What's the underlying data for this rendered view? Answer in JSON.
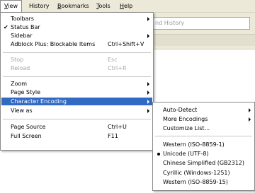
{
  "menubar": {
    "items": [
      {
        "label": "View",
        "mnemonic": "V",
        "rest": "iew"
      },
      {
        "label": "History",
        "mnemonic": "",
        "rest": "History"
      },
      {
        "label": "Bookmarks",
        "mnemonic": "B",
        "rest": "ookmarks"
      },
      {
        "label": "Tools",
        "mnemonic": "T",
        "rest": "ools"
      },
      {
        "label": "Help",
        "mnemonic": "H",
        "rest": "elp"
      }
    ]
  },
  "search": {
    "placeholder_fragment": "nd History"
  },
  "view_menu": {
    "toolbars": "Toolbars",
    "status_bar": "Status Bar",
    "status_bar_checked": "✔",
    "sidebar": "Sidebar",
    "adblock": "Adblock Plus: Blockable Items",
    "adblock_shortcut": "Ctrl+Shift+V",
    "stop": "Stop",
    "stop_shortcut": "Esc",
    "reload": "Reload",
    "reload_shortcut": "Ctrl+R",
    "zoom": "Zoom",
    "page_style": "Page Style",
    "character_encoding": "Character Encoding",
    "view_as": "View as",
    "page_source": "Page Source",
    "page_source_shortcut": "Ctrl+U",
    "full_screen": "Full Screen",
    "full_screen_shortcut": "F11"
  },
  "encoding_menu": {
    "auto_detect": "Auto-Detect",
    "more_encodings": "More Encodings",
    "customize_list": "Customize List...",
    "items": [
      {
        "label": "Western (ISO-8859-1)",
        "selected": false
      },
      {
        "label": "Unicode (UTF-8)",
        "selected": true
      },
      {
        "label": "Chinese Simplified (GB2312)",
        "selected": false
      },
      {
        "label": "Cyrillic (Windows-1251)",
        "selected": false
      },
      {
        "label": "Western (ISO-8859-15)",
        "selected": false
      }
    ]
  },
  "colors": {
    "highlight": "#316ac5",
    "menubar": "#ece9d8",
    "disabled_text": "#a6a6a6"
  }
}
